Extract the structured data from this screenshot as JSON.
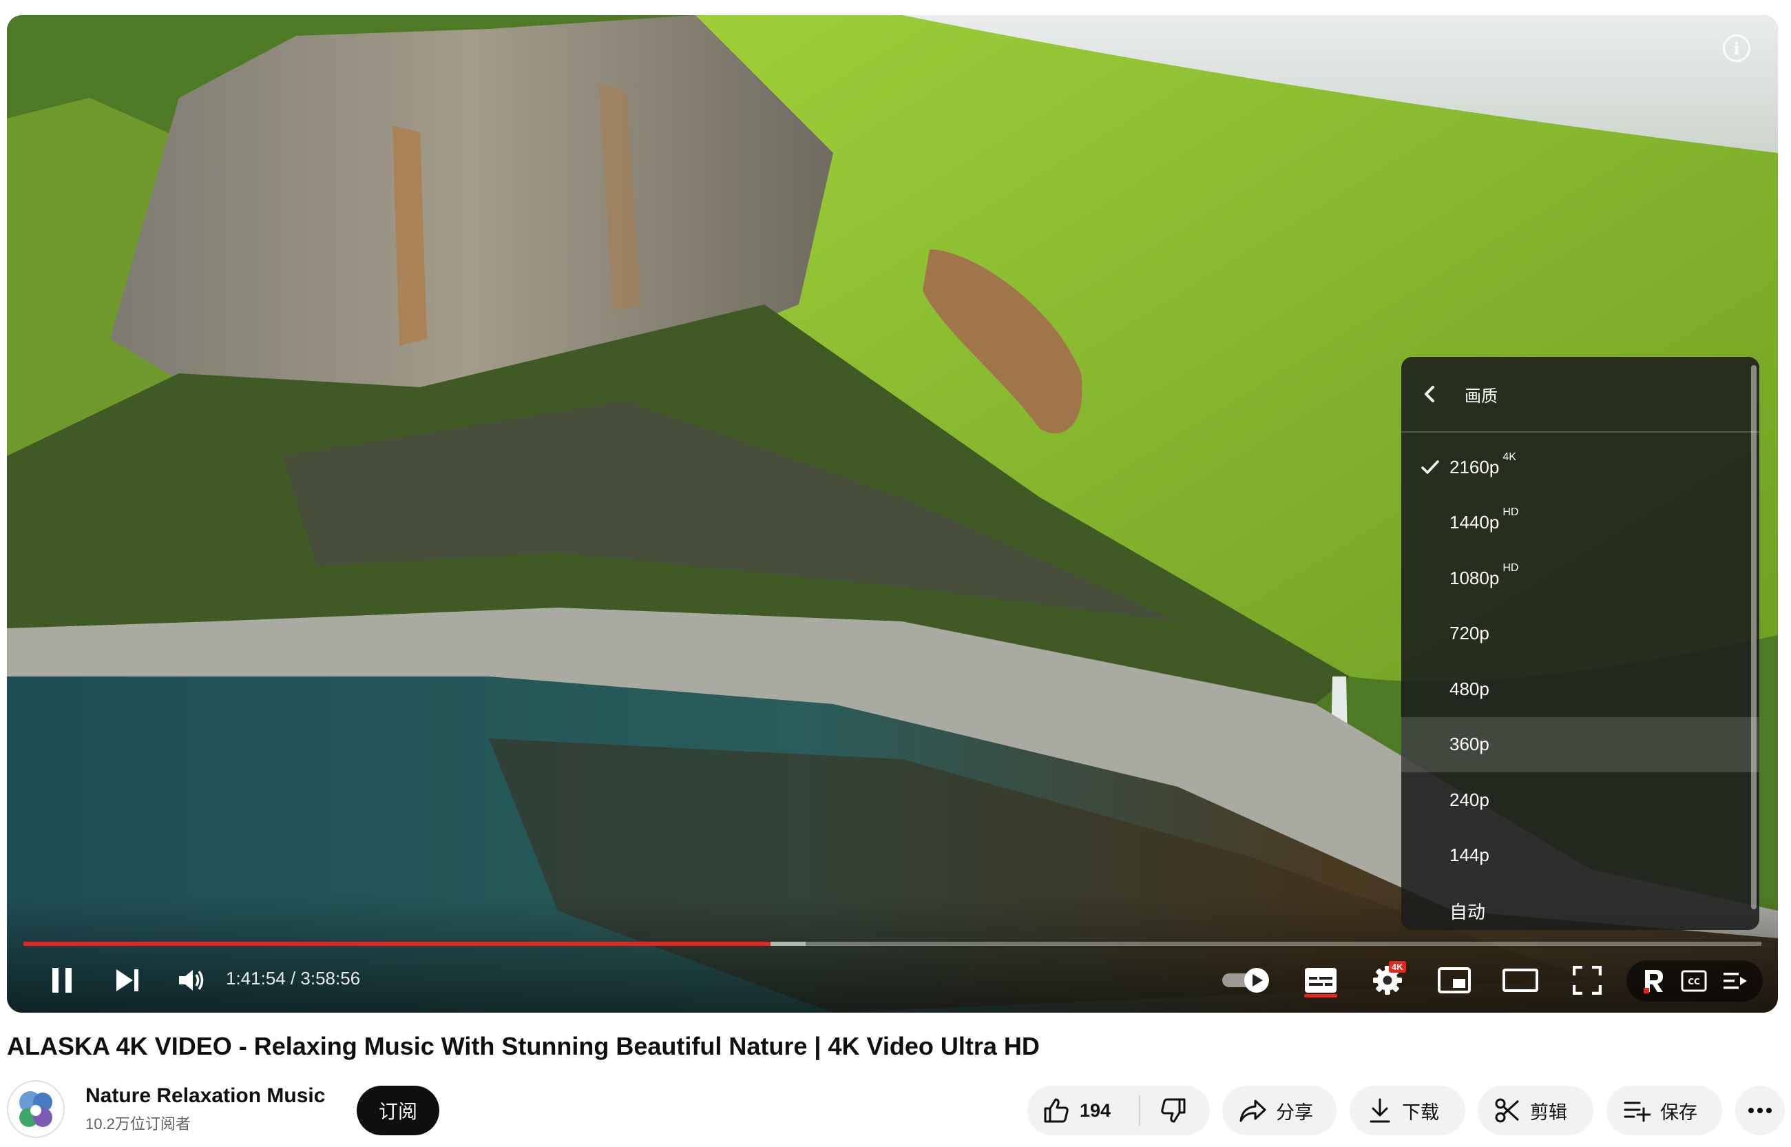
{
  "player": {
    "time_display": "1:41:54 / 3:58:56",
    "progress_fraction": 0.43,
    "buffer_fraction": 0.45,
    "settings_badge": "4K",
    "accent_color": "#e8261e"
  },
  "quality_menu": {
    "title": "画质",
    "items": [
      {
        "label": "2160p",
        "sup": "4K",
        "selected": true
      },
      {
        "label": "1440p",
        "sup": "HD",
        "selected": false
      },
      {
        "label": "1080p",
        "sup": "HD",
        "selected": false
      },
      {
        "label": "720p",
        "sup": "",
        "selected": false
      },
      {
        "label": "480p",
        "sup": "",
        "selected": false
      },
      {
        "label": "360p",
        "sup": "",
        "selected": false,
        "hovered": true
      },
      {
        "label": "240p",
        "sup": "",
        "selected": false
      },
      {
        "label": "144p",
        "sup": "",
        "selected": false
      },
      {
        "label": "自动",
        "sup": "",
        "selected": false
      }
    ]
  },
  "video": {
    "title": "ALASKA 4K VIDEO - Relaxing Music With Stunning Beautiful Nature | 4K Video Ultra HD"
  },
  "channel": {
    "name": "Nature Relaxation Music",
    "subscribers": "10.2万位订阅者",
    "subscribe_label": "订阅"
  },
  "actions": {
    "like_count": "194",
    "share_label": "分享",
    "download_label": "下载",
    "clip_label": "剪辑",
    "save_label": "保存"
  },
  "icons": [
    "info-icon",
    "pause-icon",
    "next-icon",
    "volume-icon",
    "autoplay-toggle-icon",
    "subtitles-icon",
    "settings-icon",
    "miniplayer-icon",
    "theater-icon",
    "fullscreen-icon",
    "r-logo-icon",
    "cc-icon",
    "playlist-icon",
    "back-chevron-icon",
    "check-icon",
    "like-icon",
    "dislike-icon",
    "share-icon",
    "download-icon",
    "scissors-icon",
    "save-playlist-icon",
    "more-icon"
  ]
}
